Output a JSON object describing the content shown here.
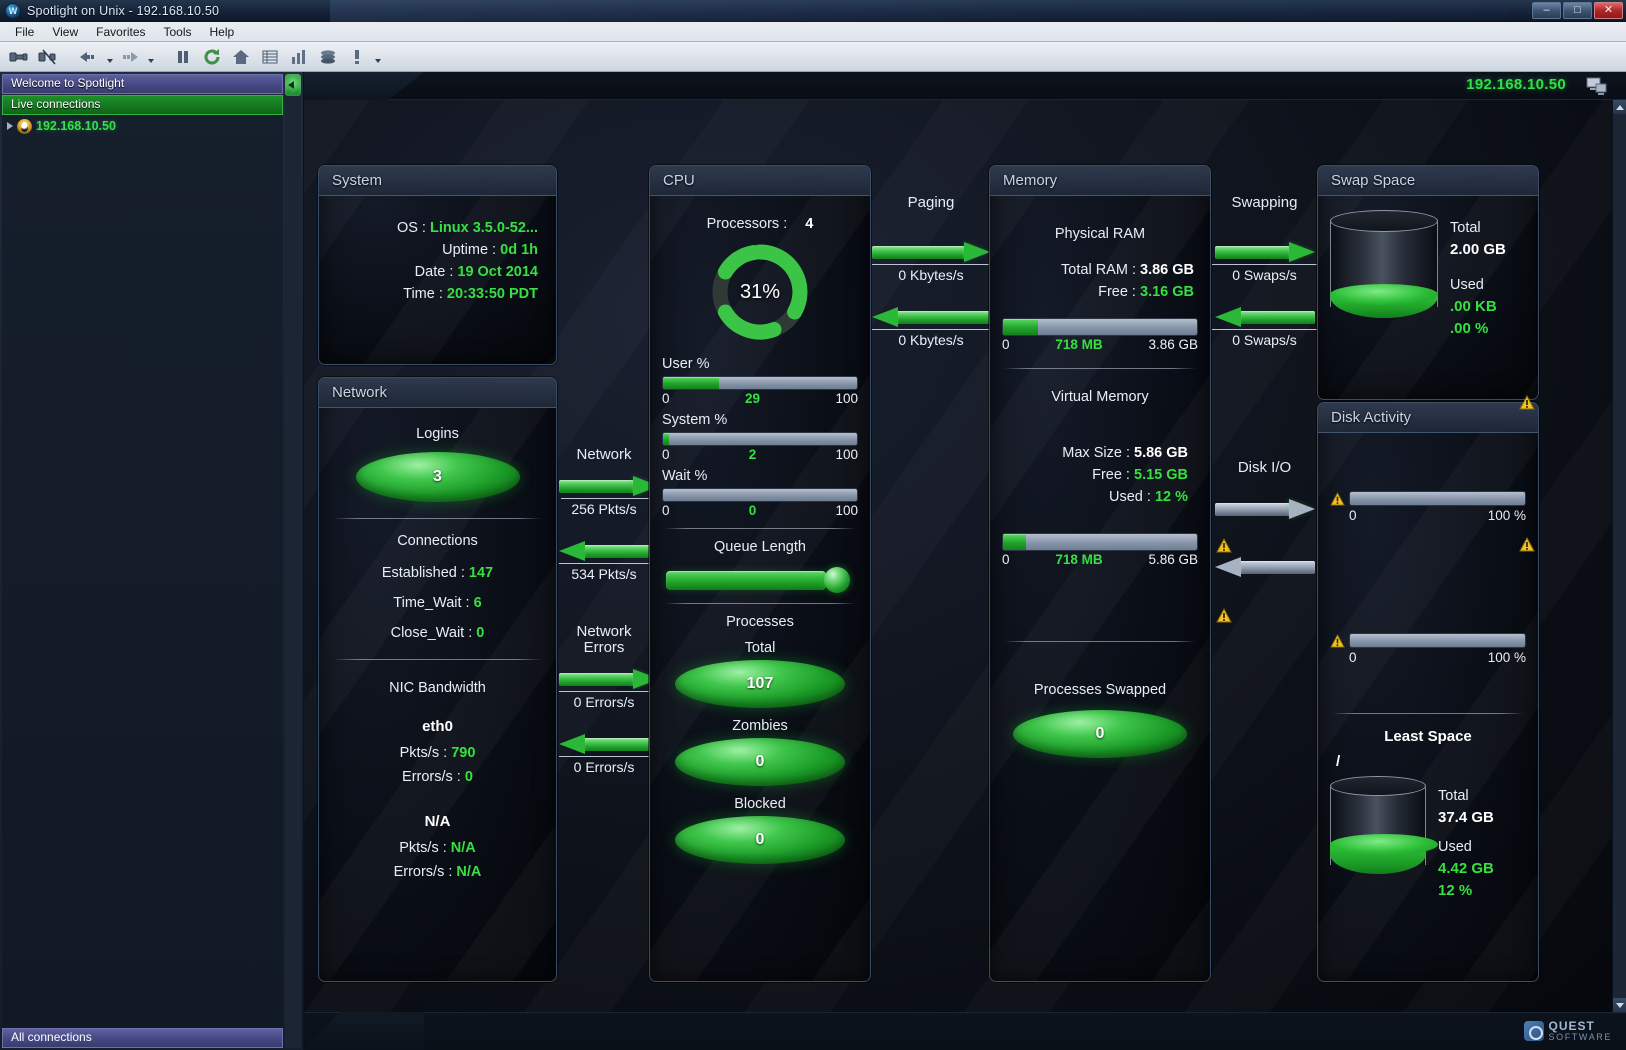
{
  "window": {
    "title": "Spotlight on Unix - 192.168.10.50",
    "minimize": "–",
    "maximize": "□",
    "close": "✕"
  },
  "menubar": [
    {
      "label": "File",
      "accel": "F"
    },
    {
      "label": "View",
      "accel": "V"
    },
    {
      "label": "Favorites",
      "accel": "a"
    },
    {
      "label": "Tools",
      "accel": "T"
    },
    {
      "label": "Help",
      "accel": "H"
    }
  ],
  "toolbar": {
    "items": [
      {
        "name": "connect-icon",
        "tip": "Connect"
      },
      {
        "name": "disconnect-icon",
        "tip": "Disconnect"
      },
      {
        "name": "back-icon",
        "tip": "Back"
      },
      {
        "name": "forward-icon",
        "tip": "Forward"
      },
      {
        "name": "pause-icon",
        "tip": "Pause"
      },
      {
        "name": "refresh-icon",
        "tip": "Refresh"
      },
      {
        "name": "home-icon",
        "tip": "Home"
      },
      {
        "name": "grid-icon",
        "tip": "Details"
      },
      {
        "name": "chart-icon",
        "tip": "Charts"
      },
      {
        "name": "layers-icon",
        "tip": "Drilldowns"
      },
      {
        "name": "alarm-icon",
        "tip": "Alarms"
      }
    ]
  },
  "sidebar": {
    "header": "Welcome to Spotlight",
    "live_connections": "Live connections",
    "node": "192.168.10.50",
    "status": "All connections"
  },
  "header": {
    "connection_ip": "192.168.10.50"
  },
  "footer": {
    "brand_line1": "QUEST",
    "brand_line2": "SOFTWARE"
  },
  "panels": {
    "system": {
      "title": "System",
      "rows": [
        {
          "key": "OS :",
          "value": "Linux 3.5.0-52..."
        },
        {
          "key": "Uptime :",
          "value": "0d 1h"
        },
        {
          "key": "Date :",
          "value": "19 Oct 2014"
        },
        {
          "key": "Time :",
          "value": "20:33:50 PDT"
        }
      ]
    },
    "network": {
      "title": "Network",
      "logins_label": "Logins",
      "logins_value": "3",
      "connections_label": "Connections",
      "connections": [
        {
          "key": "Established :",
          "value": "147"
        },
        {
          "key": "Time_Wait :",
          "value": "6"
        },
        {
          "key": "Close_Wait :",
          "value": "0"
        }
      ],
      "nic_label": "NIC Bandwidth",
      "nics": [
        {
          "name": "eth0",
          "pkts_key": "Pkts/s :",
          "pkts": "790",
          "errors_key": "Errors/s :",
          "errors": "0"
        },
        {
          "name": "N/A",
          "pkts_key": "Pkts/s :",
          "pkts": "N/A",
          "errors_key": "Errors/s :",
          "errors": "N/A"
        }
      ]
    },
    "cpu": {
      "title": "CPU",
      "processors_label": "Processors :",
      "processors_value": "4",
      "donut_pct": "31%",
      "donut_value": 31,
      "meters": [
        {
          "label": "User %",
          "min": "0",
          "value": "29",
          "max": "100",
          "pct": 29
        },
        {
          "label": "System %",
          "min": "0",
          "value": "2",
          "max": "100",
          "pct": 2
        },
        {
          "label": "Wait %",
          "min": "0",
          "value": "0",
          "max": "100",
          "pct": 0
        }
      ],
      "queue_label": "Queue Length",
      "processes_label": "Processes",
      "processes": [
        {
          "label": "Total",
          "value": "107"
        },
        {
          "label": "Zombies",
          "value": "0"
        },
        {
          "label": "Blocked",
          "value": "0"
        }
      ]
    },
    "memory": {
      "title": "Memory",
      "physical_label": "Physical RAM",
      "physical_rows": [
        {
          "key": "Total RAM :",
          "value": "3.86 GB",
          "green": false
        },
        {
          "key": "Free :",
          "value": "3.16 GB",
          "green": true
        }
      ],
      "physical_meter": {
        "min": "0",
        "value": "718 MB",
        "max": "3.86 GB",
        "pct": 18
      },
      "virtual_label": "Virtual Memory",
      "virtual_rows": [
        {
          "key": "Max Size :",
          "value": "5.86 GB",
          "green": false
        },
        {
          "key": "Free :",
          "value": "5.15 GB",
          "green": true
        },
        {
          "key": "Used :",
          "value": "12 %",
          "green": true
        }
      ],
      "virtual_meter": {
        "min": "0",
        "value": "718 MB",
        "max": "5.86 GB",
        "pct": 12
      },
      "swapped_label": "Processes Swapped",
      "swapped_value": "0"
    },
    "swap": {
      "title": "Swap Space",
      "total_label": "Total",
      "total_value": "2.00 GB",
      "used_label": "Used",
      "used_size": ".00 KB",
      "used_pct": ".00 %",
      "fill_pct": 14
    },
    "disk": {
      "title": "Disk Activity",
      "meters": [
        {
          "min": "0",
          "max": "100 %",
          "pct": 0,
          "warn": true
        },
        {
          "min": "0",
          "max": "100 %",
          "pct": 0,
          "warn": true
        }
      ],
      "warn_right_count": 3,
      "least_space_label": "Least Space",
      "mount": "/",
      "total_label": "Total",
      "total_value": "37.4 GB",
      "used_label": "Used",
      "used_size": "4.42 GB",
      "used_pct": "12 %",
      "fill_pct": 30
    }
  },
  "flows": {
    "network": {
      "label": "Network",
      "arrows": [
        {
          "dir": "right",
          "text": "256 Pkts/s"
        },
        {
          "dir": "left",
          "text": "534 Pkts/s"
        }
      ],
      "errors_label_1": "Network",
      "errors_label_2": "Errors",
      "error_arrows": [
        {
          "dir": "right",
          "text": "0 Errors/s"
        },
        {
          "dir": "left",
          "text": "0 Errors/s"
        }
      ]
    },
    "paging": {
      "label": "Paging",
      "arrows": [
        {
          "dir": "right",
          "text": "0 Kbytes/s"
        },
        {
          "dir": "left",
          "text": "0 Kbytes/s"
        }
      ]
    },
    "swapping": {
      "label": "Swapping",
      "arrows": [
        {
          "dir": "right",
          "text": "0 Swaps/s"
        },
        {
          "dir": "left",
          "text": "0 Swaps/s"
        }
      ]
    },
    "diskio": {
      "label": "Disk I/O",
      "arrows": [
        {
          "dir": "right",
          "text": ""
        },
        {
          "dir": "left",
          "text": ""
        }
      ]
    }
  }
}
